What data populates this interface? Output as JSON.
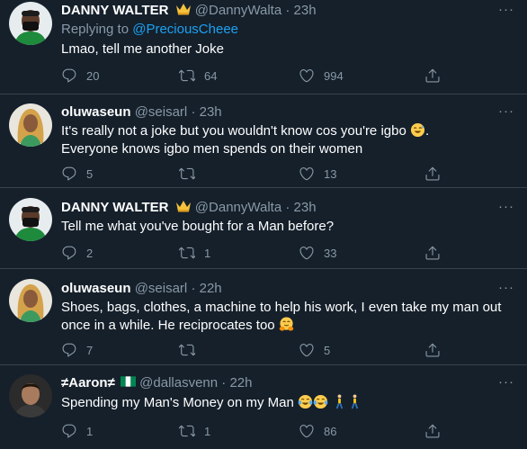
{
  "tweets": [
    {
      "name": "DANNY WALTER",
      "handle": "@DannyWalta",
      "time": "23h",
      "reply_label": "Replying to",
      "reply_handle": "@PreciousCheee",
      "text": "Lmao, tell me another Joke",
      "replies": "20",
      "retweets": "64",
      "likes": "994"
    },
    {
      "name": "oluwaseun",
      "handle": "@seisarl",
      "time": "23h",
      "text_line1": "It's really not a joke but you wouldn't know cos you're igbo",
      "text_line2": "Everyone knows igbo men spends on their women",
      "replies": "5",
      "retweets": "",
      "likes": "13"
    },
    {
      "name": "DANNY WALTER",
      "handle": "@DannyWalta",
      "time": "23h",
      "text": "Tell me what you've bought for a Man before?",
      "replies": "2",
      "retweets": "1",
      "likes": "33"
    },
    {
      "name": "oluwaseun",
      "handle": "@seisarl",
      "time": "22h",
      "text_line1": "Shoes, bags, clothes, a machine to help his work, I even take my man out",
      "text_line2": "once in a while. He reciprocates too",
      "replies": "7",
      "retweets": "",
      "likes": "5"
    },
    {
      "name": "≠Aaron≠",
      "handle": "@dallasvenn",
      "time": "22h",
      "text": "Spending my Man's Money on my Man",
      "replies": "1",
      "retweets": "1",
      "likes": "86"
    }
  ],
  "separator": "·",
  "more_glyph": "···",
  "colors": {
    "background": "#15202b",
    "secondary_text": "#8899a6",
    "link": "#1da1f2",
    "divider": "#38444d"
  },
  "icons": [
    "reply-icon",
    "retweet-icon",
    "like-icon",
    "share-icon",
    "more-icon",
    "crown-emoji",
    "nigeria-flag-emoji"
  ]
}
